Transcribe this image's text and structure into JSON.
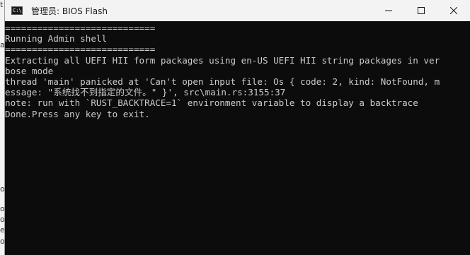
{
  "window": {
    "title": "管理员: BIOS Flash",
    "icon": "cmd-icon",
    "icon_text": "C:\\",
    "controls": [
      "minimize-icon",
      "maximize-icon",
      "close-icon"
    ]
  },
  "left_strip_glyphs": [
    "t",
    "a",
    "o",
    "o",
    "o",
    "e",
    "o"
  ],
  "console": {
    "lines": [
      "============================",
      "Running Admin shell",
      "============================",
      "Extracting all UEFI HII form packages using en-US UEFI HII string packages in ver",
      "bose mode",
      "thread 'main' panicked at 'Can't open input file: Os { code: 2, kind: NotFound, m",
      "essage: \"系统找不到指定的文件。\" }', src\\main.rs:3155:37",
      "note: run with `RUST_BACKTRACE=1` environment variable to display a backtrace",
      "Done.Press any key to exit."
    ]
  }
}
